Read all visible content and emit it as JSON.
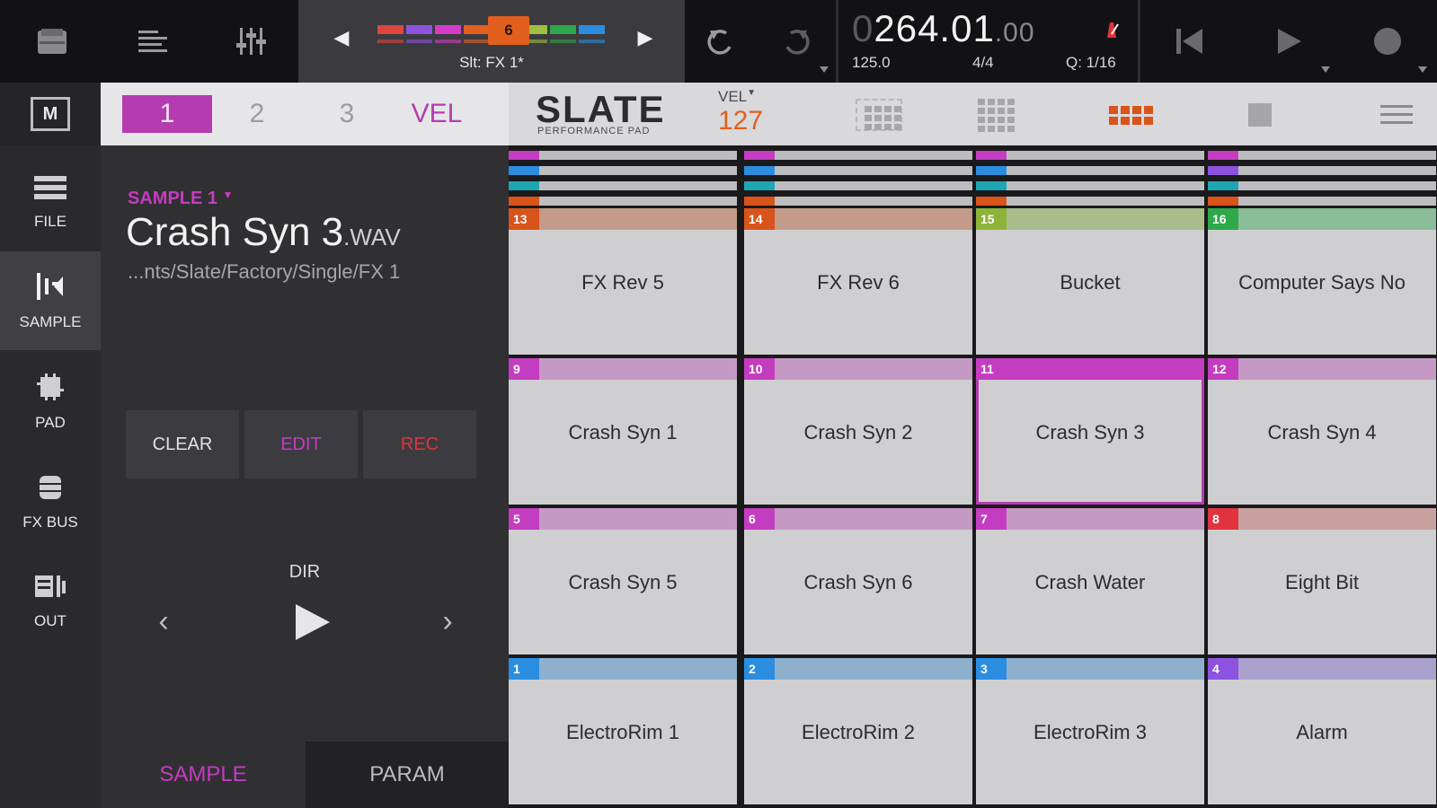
{
  "colors": {
    "accent_magenta": "#b43cb0",
    "accent_orange": "#e35f1e",
    "rec_red": "#e0333f",
    "pad_face": "#cfcfd1"
  },
  "topbar": {
    "icons": [
      "browser-icon",
      "list-icon",
      "mixer-icon"
    ],
    "sequence_number": "6",
    "sequence_label": "Slt: FX 1*",
    "strip_colors": [
      "#e0453f",
      "#8e52e0",
      "#d43cc8",
      "#e35f1e",
      "#e35f1e",
      "#a0c040",
      "#2ea84a",
      "#2a8de0"
    ],
    "undo_icon": "undo-icon",
    "redo_icon": "redo-icon",
    "time_prefix": "0",
    "time_main": "264.01",
    "time_frac": ".00",
    "tempo": "125.0",
    "time_signature": "4/4",
    "quantize": "Q: 1/16"
  },
  "leftnav": {
    "m_label": "M",
    "items": [
      {
        "label": "FILE",
        "icon": "file-list-icon"
      },
      {
        "label": "SAMPLE",
        "icon": "sample-waveform-icon"
      },
      {
        "label": "PAD",
        "icon": "pad-icon"
      },
      {
        "label": "FX BUS",
        "icon": "fx-bus-icon"
      },
      {
        "label": "OUT",
        "icon": "output-icon"
      }
    ]
  },
  "panel": {
    "layer_tabs": [
      "1",
      "2",
      "3"
    ],
    "vel_tab": "VEL",
    "sample_slot": "SAMPLE 1",
    "sample_name": "Crash Syn 3",
    "sample_ext": ".WAV",
    "sample_path": "...nts/Slate/Factory/Single/FX 1",
    "clear_label": "CLEAR",
    "edit_label": "EDIT",
    "rec_label": "REC",
    "dir_label": "DIR",
    "bottom_tabs": [
      "SAMPLE",
      "PARAM"
    ]
  },
  "pad_header": {
    "logo": "SLATE",
    "logo_sub": "PERFORMANCE PAD",
    "vel_label": "VEL",
    "vel_value": "127"
  },
  "pads": [
    {
      "num": "13",
      "label": "FX Rev 5",
      "color": "#d9541a",
      "bar": "#c49a8a"
    },
    {
      "num": "14",
      "label": "FX Rev 6",
      "color": "#d9541a",
      "bar": "#c49a8a"
    },
    {
      "num": "15",
      "label": "Bucket",
      "color": "#8eb33a",
      "bar": "#a9bd8a"
    },
    {
      "num": "16",
      "label": "Computer Says No",
      "color": "#2ea84a",
      "bar": "#8abd98"
    },
    {
      "num": "9",
      "label": "Crash Syn 1",
      "color": "#c43cc0",
      "bar": "#c49ac4"
    },
    {
      "num": "10",
      "label": "Crash Syn 2",
      "color": "#c43cc0",
      "bar": "#c49ac4"
    },
    {
      "num": "11",
      "label": "Crash Syn 3",
      "color": "#c43cc0",
      "bar": "#c43cc0"
    },
    {
      "num": "12",
      "label": "Crash Syn 4",
      "color": "#c43cc0",
      "bar": "#c49ac4"
    },
    {
      "num": "5",
      "label": "Crash Syn 5",
      "color": "#c43cc0",
      "bar": "#c49ac4"
    },
    {
      "num": "6",
      "label": "Crash Syn 6",
      "color": "#c43cc0",
      "bar": "#c49ac4"
    },
    {
      "num": "7",
      "label": "Crash Water",
      "color": "#c43cc0",
      "bar": "#c49ac4"
    },
    {
      "num": "8",
      "label": "Eight Bit",
      "color": "#e0333f",
      "bar": "#c9a0a0"
    },
    {
      "num": "1",
      "label": "ElectroRim 1",
      "color": "#2a8de0",
      "bar": "#8eb0cc"
    },
    {
      "num": "2",
      "label": "ElectroRim 2",
      "color": "#2a8de0",
      "bar": "#8eb0cc"
    },
    {
      "num": "3",
      "label": "ElectroRim 3",
      "color": "#2a8de0",
      "bar": "#8eb0cc"
    },
    {
      "num": "4",
      "label": "Alarm",
      "color": "#8e52e0",
      "bar": "#aaa0cc"
    }
  ],
  "selected_pad": "11"
}
